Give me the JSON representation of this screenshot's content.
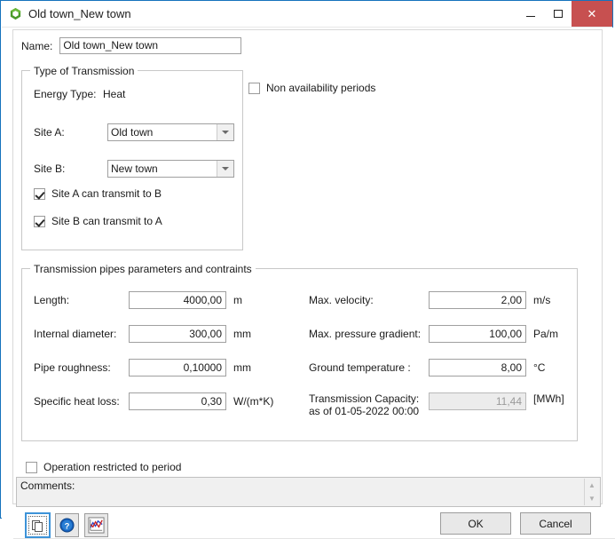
{
  "window": {
    "title": "Old town_New town",
    "icon": "hexagon-icon",
    "controls": {
      "minimize": "minimize-icon",
      "maximize": "maximize-icon",
      "close": "✕"
    }
  },
  "name_field": {
    "label": "Name:",
    "value": "Old town_New town",
    "placeholder": ""
  },
  "transmission_group": {
    "title": "Type of Transmission",
    "energy_type_label": "Energy Type:",
    "energy_type_value": "Heat",
    "site_a_label": "Site A:",
    "site_a_value": "Old town",
    "site_b_label": "Site B:",
    "site_b_value": "New town",
    "checkbox_a_to_b": {
      "label": "Site A can transmit to B",
      "checked": true
    },
    "checkbox_b_to_a": {
      "label": "Site B can transmit to A",
      "checked": true
    }
  },
  "non_availability": {
    "label": "Non availability periods",
    "checked": false
  },
  "pipes_group": {
    "title": "Transmission pipes parameters and contraints",
    "left_fields": [
      {
        "label": "Length:",
        "value": "4000,00",
        "unit": "m",
        "disabled": false
      },
      {
        "label": "Internal diameter:",
        "value": "300,00",
        "unit": "mm",
        "disabled": false
      },
      {
        "label": "Pipe roughness:",
        "value": "0,10000",
        "unit": "mm",
        "disabled": false
      },
      {
        "label": "Specific heat loss:",
        "value": "0,30",
        "unit": "W/(m*K)",
        "disabled": false
      }
    ],
    "right_fields": [
      {
        "label": "Max. velocity:",
        "value": "2,00",
        "unit": "m/s",
        "disabled": false
      },
      {
        "label": "Max. pressure gradient:",
        "value": "100,00",
        "unit": "Pa/m",
        "disabled": false
      },
      {
        "label": "Ground temperature :",
        "value": "8,00",
        "unit": "°C",
        "disabled": false
      }
    ],
    "capacity_field": {
      "label_line1": "Transmission Capacity:",
      "label_line2": "as of 01-05-2022 00:00",
      "value": "11,44",
      "unit": "[MWh]",
      "disabled": true
    }
  },
  "operation_restricted": {
    "label": "Operation restricted to period",
    "checked": false
  },
  "comments": {
    "label": "Comments:",
    "value": ""
  },
  "toolbar": {
    "buttons": [
      {
        "name": "copy-button",
        "icon": "copy-icon",
        "focused": true
      },
      {
        "name": "help-button",
        "icon": "help-icon",
        "focused": false
      },
      {
        "name": "chart-button",
        "icon": "chart-icon",
        "focused": false
      }
    ]
  },
  "dialog_buttons": {
    "ok": "OK",
    "cancel": "Cancel"
  },
  "colors": {
    "window_border": "#1673bd",
    "close_button": "#c75050",
    "icon_green": "#4a9a2a",
    "help_blue": "#1560bd",
    "focus_blue": "#3d93d8"
  }
}
